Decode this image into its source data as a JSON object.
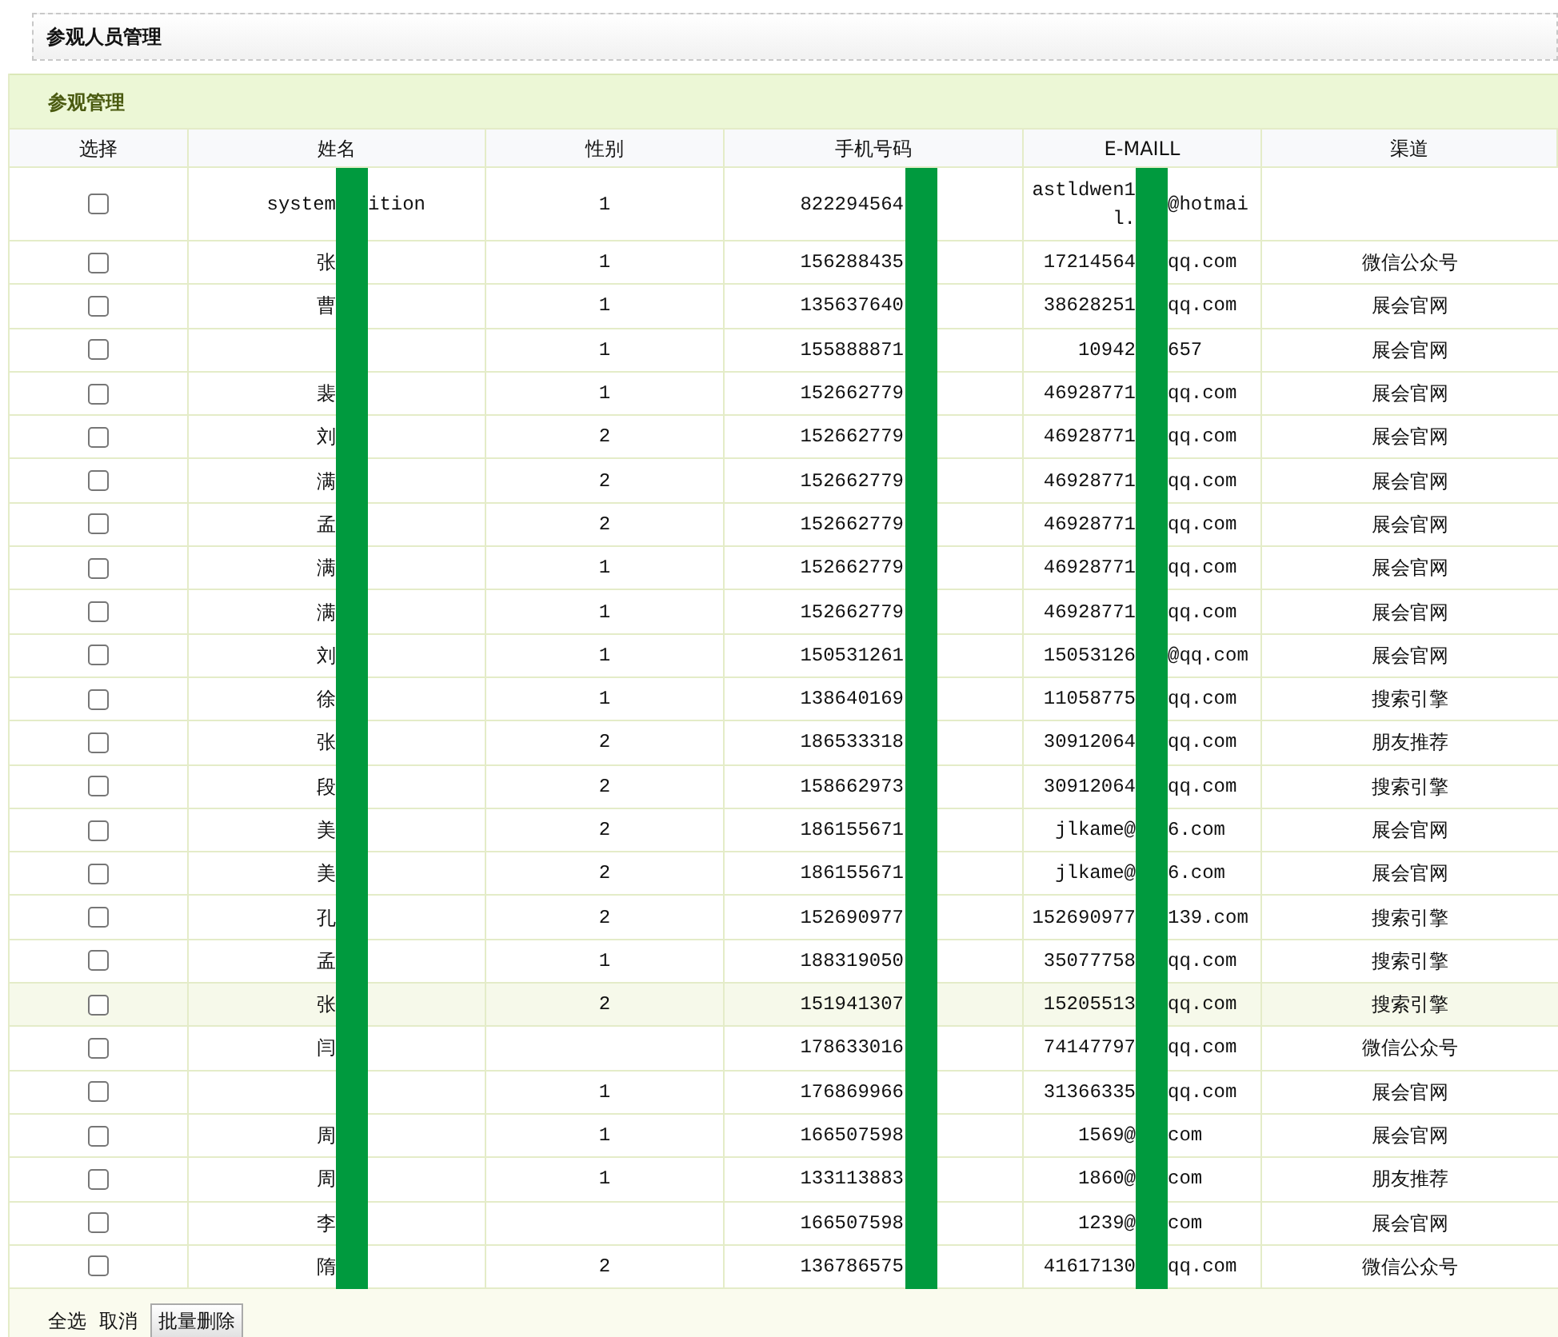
{
  "page_title": "参观人员管理",
  "panel": {
    "title": "参观管理",
    "columns": [
      "选择",
      "姓名",
      "性别",
      "手机号码",
      "E-MAILL",
      "渠道"
    ],
    "rows": [
      {
        "checked": false,
        "highlighted": false,
        "name_before": "system",
        "name_after": "ition",
        "sex": "1",
        "phone": "822294564",
        "email_before": "astldwen1\nl.",
        "email_after": "@hotmai",
        "channel": ""
      },
      {
        "checked": false,
        "highlighted": false,
        "name_before": "张",
        "name_after": "",
        "sex": "1",
        "phone": "156288435",
        "email_before": "17214564",
        "email_after": "qq.com",
        "channel": "微信公众号"
      },
      {
        "checked": false,
        "highlighted": false,
        "name_before": "曹",
        "name_after": "",
        "sex": "1",
        "phone": "135637640",
        "email_before": "38628251",
        "email_after": "qq.com",
        "channel": "展会官网"
      },
      {
        "checked": false,
        "highlighted": false,
        "name_before": "",
        "name_after": "",
        "sex": "1",
        "phone": "155888871",
        "email_before": "10942",
        "email_after": "657",
        "channel": "展会官网"
      },
      {
        "checked": false,
        "highlighted": false,
        "name_before": "裴",
        "name_after": "",
        "sex": "1",
        "phone": "152662779",
        "email_before": "46928771",
        "email_after": "qq.com",
        "channel": "展会官网"
      },
      {
        "checked": false,
        "highlighted": false,
        "name_before": "刘",
        "name_after": "",
        "sex": "2",
        "phone": "152662779",
        "email_before": "46928771",
        "email_after": "qq.com",
        "channel": "展会官网"
      },
      {
        "checked": false,
        "highlighted": false,
        "name_before": "满",
        "name_after": "",
        "sex": "2",
        "phone": "152662779",
        "email_before": "46928771",
        "email_after": "qq.com",
        "channel": "展会官网"
      },
      {
        "checked": false,
        "highlighted": false,
        "name_before": "孟",
        "name_after": "",
        "sex": "2",
        "phone": "152662779",
        "email_before": "46928771",
        "email_after": "qq.com",
        "channel": "展会官网"
      },
      {
        "checked": false,
        "highlighted": false,
        "name_before": "满",
        "name_after": "",
        "sex": "1",
        "phone": "152662779",
        "email_before": "46928771",
        "email_after": "qq.com",
        "channel": "展会官网"
      },
      {
        "checked": false,
        "highlighted": false,
        "name_before": "满",
        "name_after": "",
        "sex": "1",
        "phone": "152662779",
        "email_before": "46928771",
        "email_after": "qq.com",
        "channel": "展会官网"
      },
      {
        "checked": false,
        "highlighted": false,
        "name_before": "刘",
        "name_after": "",
        "sex": "1",
        "phone": "150531261",
        "email_before": "15053126",
        "email_after": "@qq.com",
        "channel": "展会官网"
      },
      {
        "checked": false,
        "highlighted": false,
        "name_before": "徐",
        "name_after": "",
        "sex": "1",
        "phone": "138640169",
        "email_before": "11058775",
        "email_after": "qq.com",
        "channel": "搜索引擎"
      },
      {
        "checked": false,
        "highlighted": false,
        "name_before": "张",
        "name_after": "",
        "sex": "2",
        "phone": "186533318",
        "email_before": "30912064",
        "email_after": "qq.com",
        "channel": "朋友推荐"
      },
      {
        "checked": false,
        "highlighted": false,
        "name_before": "段",
        "name_after": "",
        "sex": "2",
        "phone": "158662973",
        "email_before": "30912064",
        "email_after": "qq.com",
        "channel": "搜索引擎"
      },
      {
        "checked": false,
        "highlighted": false,
        "name_before": "美",
        "name_after": "",
        "sex": "2",
        "phone": "186155671",
        "email_before": "jlkame@",
        "email_after": "6.com",
        "channel": "展会官网"
      },
      {
        "checked": false,
        "highlighted": false,
        "name_before": "美",
        "name_after": "",
        "sex": "2",
        "phone": "186155671",
        "email_before": "jlkame@",
        "email_after": "6.com",
        "channel": "展会官网"
      },
      {
        "checked": false,
        "highlighted": false,
        "name_before": "孔",
        "name_after": "",
        "sex": "2",
        "phone": "152690977",
        "email_before": "152690977",
        "email_after": "139.com",
        "channel": "搜索引擎"
      },
      {
        "checked": false,
        "highlighted": false,
        "name_before": "孟",
        "name_after": "",
        "sex": "1",
        "phone": "188319050",
        "email_before": "35077758",
        "email_after": "qq.com",
        "channel": "搜索引擎"
      },
      {
        "checked": false,
        "highlighted": true,
        "name_before": "张",
        "name_after": "",
        "sex": "2",
        "phone": "151941307",
        "email_before": "15205513",
        "email_after": "qq.com",
        "channel": "搜索引擎"
      },
      {
        "checked": false,
        "highlighted": false,
        "name_before": "闫",
        "name_after": "",
        "sex": "",
        "phone": "178633016",
        "email_before": "74147797",
        "email_after": "qq.com",
        "channel": "微信公众号"
      },
      {
        "checked": false,
        "highlighted": false,
        "name_before": "",
        "name_after": "",
        "sex": "1",
        "phone": "176869966",
        "email_before": "31366335",
        "email_after": "qq.com",
        "channel": "展会官网"
      },
      {
        "checked": false,
        "highlighted": false,
        "name_before": "周",
        "name_after": "",
        "sex": "1",
        "phone": "166507598",
        "email_before": "1569@",
        "email_after": "com",
        "channel": "展会官网"
      },
      {
        "checked": false,
        "highlighted": false,
        "name_before": "周",
        "name_after": "",
        "sex": "1",
        "phone": "133113883",
        "email_before": "1860@",
        "email_after": "com",
        "channel": "朋友推荐"
      },
      {
        "checked": false,
        "highlighted": false,
        "name_before": "李",
        "name_after": "",
        "sex": "",
        "phone": "166507598",
        "email_before": "1239@",
        "email_after": "com",
        "channel": "展会官网"
      },
      {
        "checked": false,
        "highlighted": false,
        "name_before": "隋",
        "name_after": "",
        "sex": "2",
        "phone": "136786575",
        "email_before": "41617130",
        "email_after": "qq.com",
        "channel": "微信公众号"
      }
    ]
  },
  "footer": {
    "select_all": "全选",
    "cancel": "取消",
    "batch_delete": "批量删除"
  }
}
